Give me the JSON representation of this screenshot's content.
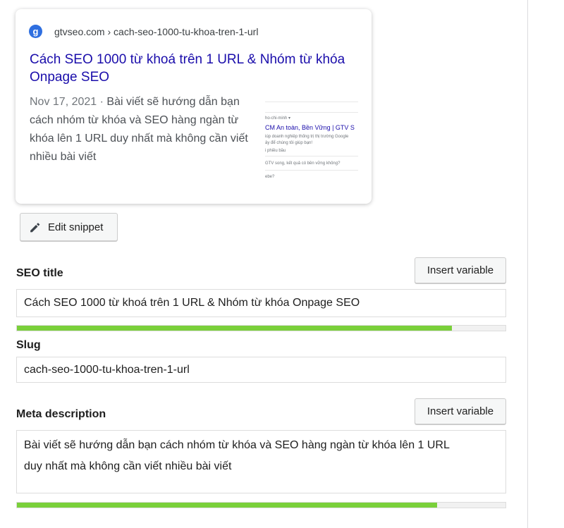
{
  "preview": {
    "favicon_letter": "g",
    "breadcrumb": "gtvseo.com › cach-seo-1000-tu-khoa-tren-1-url",
    "title": "Cách SEO 1000 từ khoá trên 1 URL & Nhóm từ khóa Onpage SEO",
    "date": "Nov 17, 2021",
    "date_separator": " · ",
    "description": "Bài viết sẽ hướng dẫn bạn cách nhóm từ khóa và SEO hàng ngàn từ khóa lên 1 URL duy nhất mà không cần viết nhiều bài viết",
    "thumbnail": {
      "line1": "ho-chi-minh ▾",
      "line2": "CM An toàn, Bền Vững | GTV S",
      "line3": "iúp doanh nghiệp thống trị thị trường Google",
      "line4": "ây để chúng tôi giúp bạn!",
      "line5": "i phiều bầu",
      "line6": "GTV song, kết quả có bền vững không?",
      "line7": "ebe?"
    }
  },
  "edit_snippet": {
    "label": "Edit snippet",
    "icon": "pencil-icon"
  },
  "seo_title": {
    "label": "SEO title",
    "insert_label": "Insert variable",
    "value": "Cách SEO 1000 từ khoá trên 1 URL & Nhóm từ khóa Onpage SEO",
    "progress_fraction": 0.89,
    "progress_color": "#7ad03a"
  },
  "slug": {
    "label": "Slug",
    "value": "cach-seo-1000-tu-khoa-tren-1-url"
  },
  "meta_description": {
    "label": "Meta description",
    "insert_label": "Insert variable",
    "line1": "Bài viết sẽ hướng dẫn bạn cách nhóm từ khóa và SEO hàng ngàn từ khóa lên 1 URL",
    "line2": "duy nhất mà không cần viết nhiều bài viết",
    "progress_fraction": 0.86,
    "progress_color": "#7ad03a"
  }
}
